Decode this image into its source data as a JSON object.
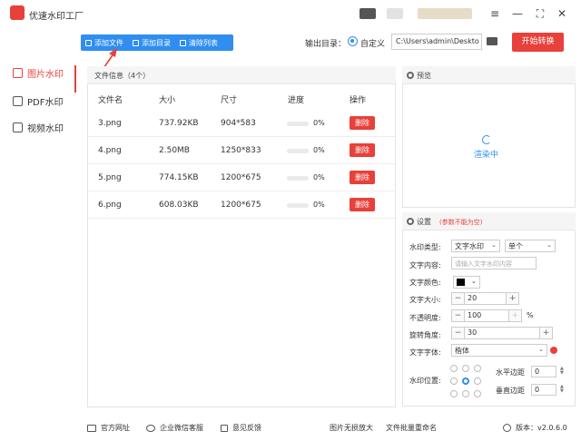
{
  "app": {
    "title": "优速水印工厂"
  },
  "window_controls": {
    "menu": "≡",
    "minimize": "—",
    "maximize": "⛶",
    "close": "✕"
  },
  "sidebar": {
    "items": [
      {
        "label": "图片水印",
        "icon": "image-icon",
        "active": true
      },
      {
        "label": "PDF水印",
        "icon": "pdf-icon",
        "active": false
      },
      {
        "label": "视频水印",
        "icon": "video-icon",
        "active": false
      }
    ]
  },
  "toolbar": {
    "add_file": "添加文件",
    "add_folder": "添加目录",
    "clear_list": "清除列表"
  },
  "output": {
    "label": "输出目录：",
    "mode": "自定义",
    "path": "C:\\Users\\admin\\Deskto"
  },
  "start_button": "开始转换",
  "file_panel": {
    "title": "文件信息（4个）",
    "columns": [
      "文件名",
      "大小",
      "尺寸",
      "进度",
      "操作"
    ],
    "rows": [
      {
        "name": "3.png",
        "size": "737.92KB",
        "dim": "904*583",
        "progress": "0%",
        "action": "删除"
      },
      {
        "name": "4.png",
        "size": "2.50MB",
        "dim": "1250*833",
        "progress": "0%",
        "action": "删除"
      },
      {
        "name": "5.png",
        "size": "774.15KB",
        "dim": "1200*675",
        "progress": "0%",
        "action": "删除"
      },
      {
        "name": "6.png",
        "size": "608.03KB",
        "dim": "1200*675",
        "progress": "0%",
        "action": "删除"
      }
    ]
  },
  "preview": {
    "title": "预览",
    "status": "渲染中"
  },
  "settings": {
    "title": "设置",
    "note": "(参数不能为空)",
    "watermark_type_label": "水印类型:",
    "watermark_type": "文字水印",
    "layout": "单个",
    "text_content_label": "文字内容:",
    "text_placeholder": "请输入文字水印内容",
    "text_color_label": "文字颜色:",
    "text_color": "#000000",
    "font_size_label": "文字大小:",
    "font_size": "20",
    "opacity_label": "不透明度:",
    "opacity": "100",
    "opacity_unit": "%",
    "rotation_label": "旋转角度:",
    "rotation": "30",
    "font_label": "文字字体:",
    "font": "楷体",
    "position_label": "水印位置:",
    "h_margin_label": "水平边距",
    "h_margin": "0",
    "v_margin_label": "垂直边距",
    "v_margin": "0",
    "minus": "−",
    "plus": "+"
  },
  "footer": {
    "website": "官方网址",
    "wechat": "企业微信客服",
    "feedback": "意见反馈",
    "enlarge": "图片无损放大",
    "rename": "文件批量重命名",
    "version": "版本：v2.0.6.0"
  },
  "colors": {
    "accent": "#e8403a",
    "primary": "#2f8ef0"
  }
}
